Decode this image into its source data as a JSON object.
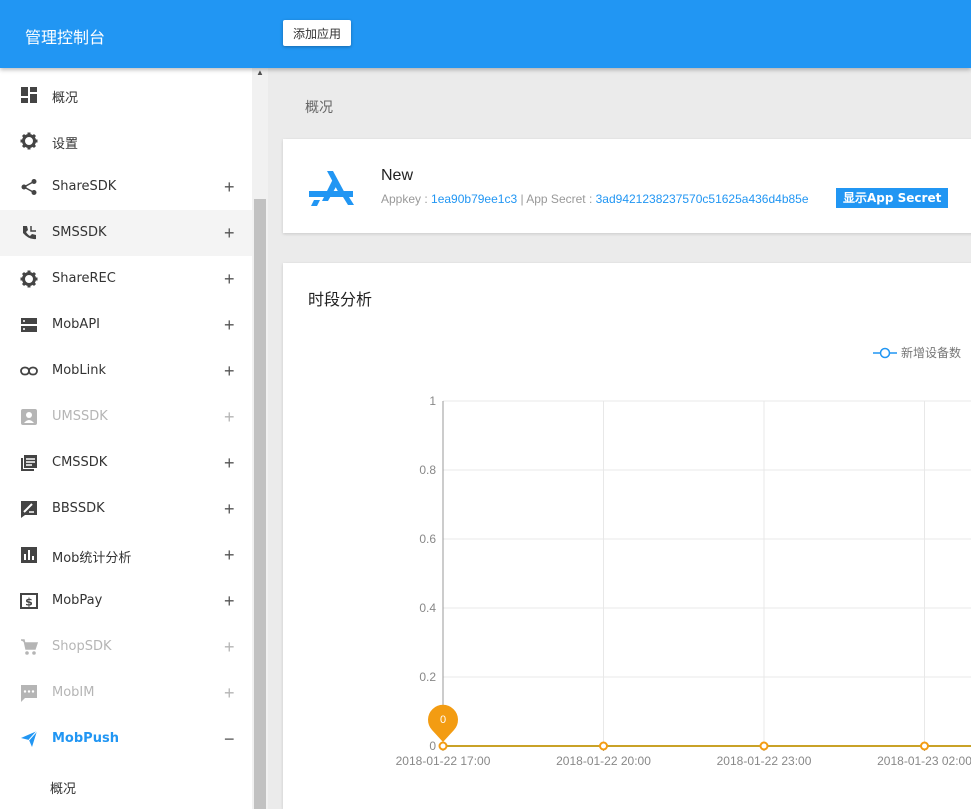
{
  "header": {
    "brand": "管理控制台",
    "add_app_label": "添加应用"
  },
  "sidebar": {
    "items": [
      {
        "label": "概况",
        "icon": "dashboard-icon",
        "expandable": false,
        "state": "normal"
      },
      {
        "label": "设置",
        "icon": "gear-icon",
        "expandable": false,
        "state": "normal"
      },
      {
        "label": "ShareSDK",
        "icon": "share-icon",
        "expandable": true,
        "state": "normal"
      },
      {
        "label": "SMSSDK",
        "icon": "phone-icon",
        "expandable": true,
        "state": "highlighted"
      },
      {
        "label": "ShareREC",
        "icon": "gear-icon",
        "expandable": true,
        "state": "normal"
      },
      {
        "label": "MobAPI",
        "icon": "server-icon",
        "expandable": true,
        "state": "normal"
      },
      {
        "label": "MobLink",
        "icon": "link-icon",
        "expandable": true,
        "state": "normal"
      },
      {
        "label": "UMSSDK",
        "icon": "user-box-icon",
        "expandable": true,
        "state": "disabled"
      },
      {
        "label": "CMSSDK",
        "icon": "library-icon",
        "expandable": true,
        "state": "normal"
      },
      {
        "label": "BBSSDK",
        "icon": "forum-edit-icon",
        "expandable": true,
        "state": "normal"
      },
      {
        "label": "Mob统计分析",
        "icon": "bar-chart-icon",
        "expandable": true,
        "state": "normal"
      },
      {
        "label": "MobPay",
        "icon": "dollar-icon",
        "expandable": true,
        "state": "normal"
      },
      {
        "label": "ShopSDK",
        "icon": "cart-icon",
        "expandable": true,
        "state": "disabled"
      },
      {
        "label": "MobIM",
        "icon": "chat-icon",
        "expandable": true,
        "state": "disabled"
      },
      {
        "label": "MobPush",
        "icon": "send-icon",
        "expandable": true,
        "state": "expanded"
      }
    ],
    "plus_symbol": "+",
    "minus_symbol": "−",
    "sub_item": "概况"
  },
  "breadcrumb": "概况",
  "app": {
    "name": "New",
    "appkey_label": "Appkey : ",
    "appkey": "1ea90b79ee1c3",
    "separator": " | ",
    "secret_label": "App Secret : ",
    "secret": "3ad9421238237570c51625a436d4b85e",
    "show_secret_label": "显示App Secret"
  },
  "chart_card": {
    "title": "时段分析"
  },
  "chart_data": {
    "type": "line",
    "legend": [
      "新增设备数"
    ],
    "legend_placement": "top-right",
    "categories": [
      "2018-01-22 17:00",
      "2018-01-22 20:00",
      "2018-01-22 23:00",
      "2018-01-23 02:00"
    ],
    "series": [
      {
        "name": "新增设备数",
        "values": [
          0,
          0,
          0,
          0
        ]
      }
    ],
    "y_ticks": [
      "1",
      "0.8",
      "0.6",
      "0.4",
      "0.2",
      "0"
    ],
    "ylim": [
      0,
      1
    ],
    "marker_label": "0",
    "grid": true
  },
  "colors": {
    "primary": "#2196f3",
    "series_line": "#c9a227",
    "marker": "#f39c12",
    "disabled": "#b5b5b5"
  }
}
